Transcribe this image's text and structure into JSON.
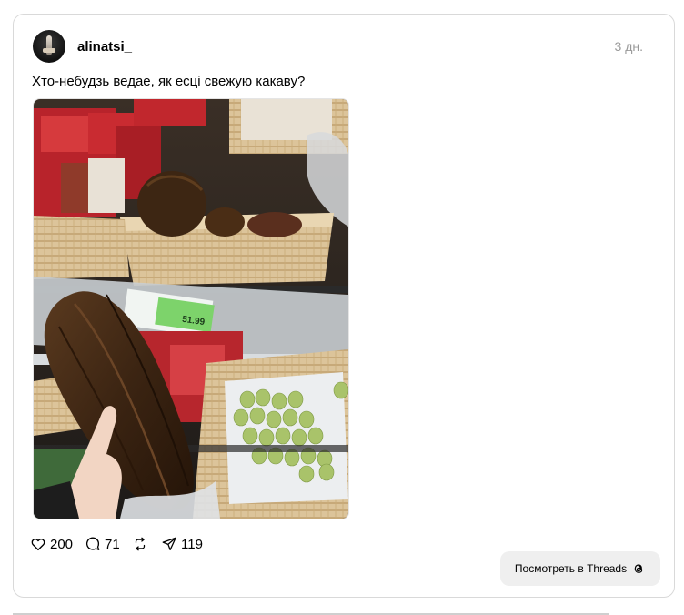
{
  "post": {
    "username": "alinatsi_",
    "time": "3 дн.",
    "caption": "Хто-небудзь ведае, як есці свежую какаву?",
    "price_tag": "51.99",
    "likes": "200",
    "comments": "71",
    "shares": "119",
    "view_button": "Посмотреть в Threads"
  },
  "icons": {
    "like": "heart-icon",
    "comment": "comment-bubble-icon",
    "repost": "repost-icon",
    "share": "send-icon",
    "threads": "threads-logo-icon"
  },
  "colors": {
    "border": "#d9d9d9",
    "muted_text": "#999999",
    "button_bg": "#efefef"
  }
}
